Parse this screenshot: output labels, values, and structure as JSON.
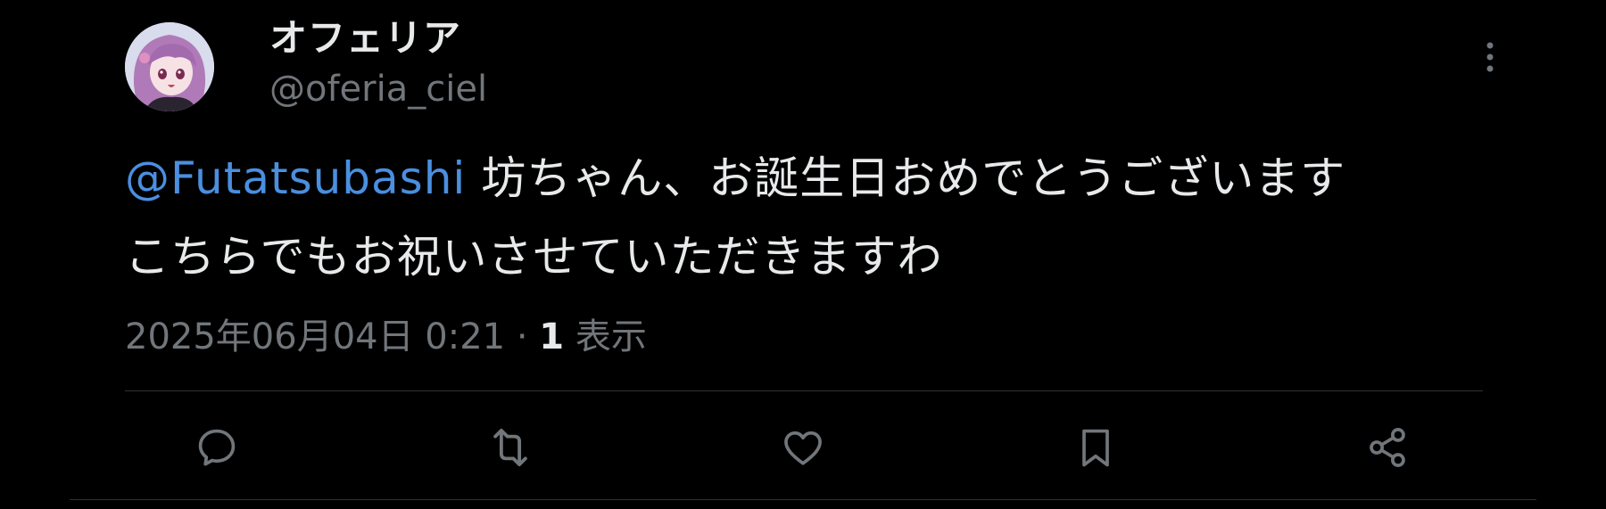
{
  "tweet": {
    "author": {
      "display_name": "オフェリア",
      "handle": "@oferia_ciel"
    },
    "text": {
      "mention": "@Futatsubashi",
      "line1_rest": " 坊ちゃん、お誕生日おめでとうございます",
      "line2": "こちらでもお祝いさせていただきますわ"
    },
    "meta": {
      "timestamp": "2025年06月04日 0:21",
      "separator": " · ",
      "views_count": "1",
      "views_label": " 表示"
    },
    "actions": [
      {
        "icon": "reply-icon"
      },
      {
        "icon": "retweet-icon"
      },
      {
        "icon": "like-icon"
      },
      {
        "icon": "bookmark-icon"
      },
      {
        "icon": "share-icon"
      }
    ],
    "colors": {
      "background": "#000000",
      "primary_text": "#e7e9ea",
      "secondary_text": "#71767b",
      "mention": "#4a8fe0",
      "divider": "#2f3336"
    }
  }
}
